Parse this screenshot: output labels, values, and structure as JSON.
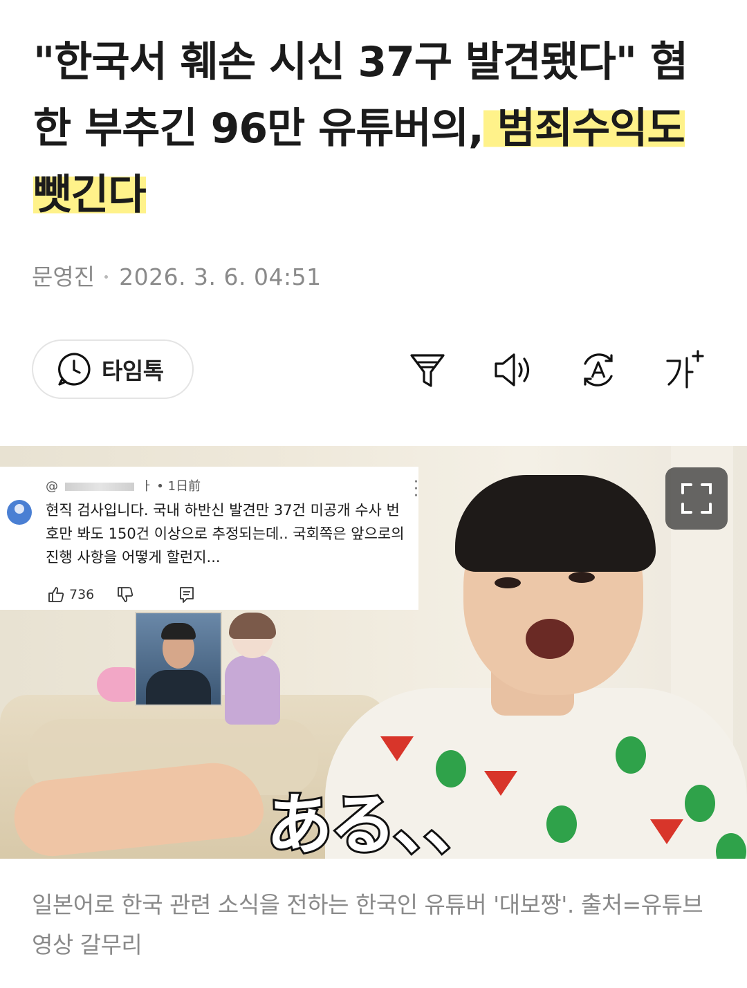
{
  "article": {
    "headline_part1": "\"한국서 훼손 시신 37구 발견됐다\" 혐한 부추긴 96만 유튜버의,",
    "headline_part2": " 범죄수익도 뺏긴다",
    "author": "문영진",
    "date": "2026. 3. 6. 04:51"
  },
  "toolbar": {
    "timetalk_label": "타임톡",
    "font_size_label": "가"
  },
  "image": {
    "comment": {
      "handle_prefix": "@",
      "handle_suffix": "ㅏ • 1日前",
      "text": "현직 검사입니다. 국내 하반신 발견만 37건 미공개 수사 번호만 봐도 150건 이상으로 추정되는데.. 국회쪽은 앞으로의 진행 사항을 어떻게 할런지...",
      "likes": "736"
    },
    "subtitle": "ある、、"
  },
  "caption": "일본어로 한국 관련 소식을 전하는 한국인 유튜버 '대보짱'. 출처=유튜브 영상 갈무리",
  "colors": {
    "highlight": "#fff28a",
    "meta_gray": "#8a8a8a"
  }
}
